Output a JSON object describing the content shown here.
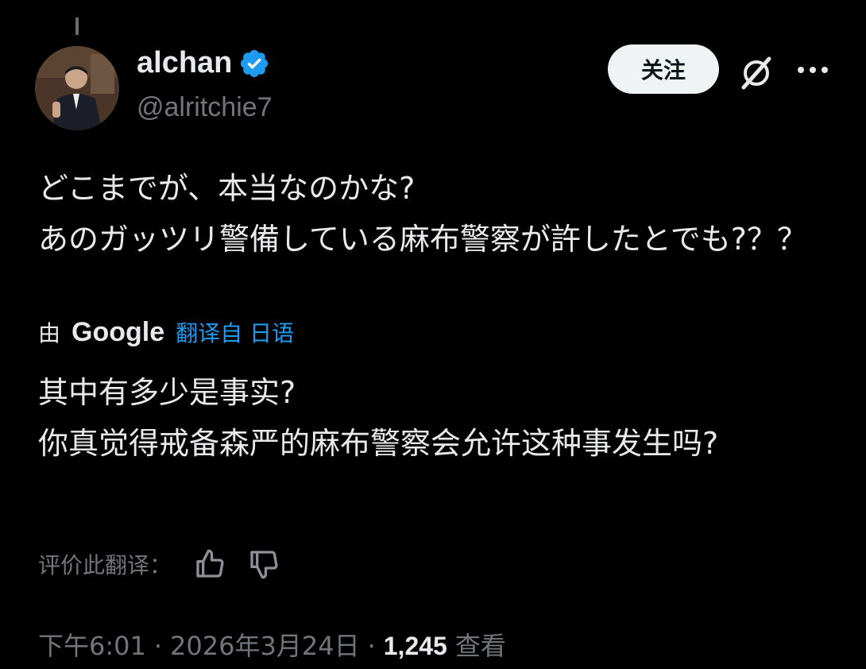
{
  "author": {
    "name": "alchan",
    "handle": "@alritchie7",
    "verified": true
  },
  "header": {
    "follow_label": "关注"
  },
  "post": {
    "original_text": "どこまでが、本当なのかな?\nあのガッツリ警備している麻布警察が許したとでも?？？",
    "translation_by": "由",
    "translation_provider": "Google",
    "translation_link": "翻译自 日语",
    "translated_text": "其中有多少是事实?\n你真觉得戒备森严的麻布警察会允许这种事发生吗?",
    "rate_label": "评价此翻译：",
    "time": "下午6:01",
    "date": "2026年3月24日",
    "views_count": "1,245",
    "views_label": "查看"
  },
  "colors": {
    "background": "#000000",
    "text": "#e7e9ea",
    "muted": "#71767b",
    "link": "#1d9bf0",
    "verified": "#1d9bf0",
    "button_bg": "#eff3f4"
  },
  "icons": [
    "verified-badge-icon",
    "grok-icon",
    "more-icon",
    "thumbs-up-icon",
    "thumbs-down-icon"
  ]
}
